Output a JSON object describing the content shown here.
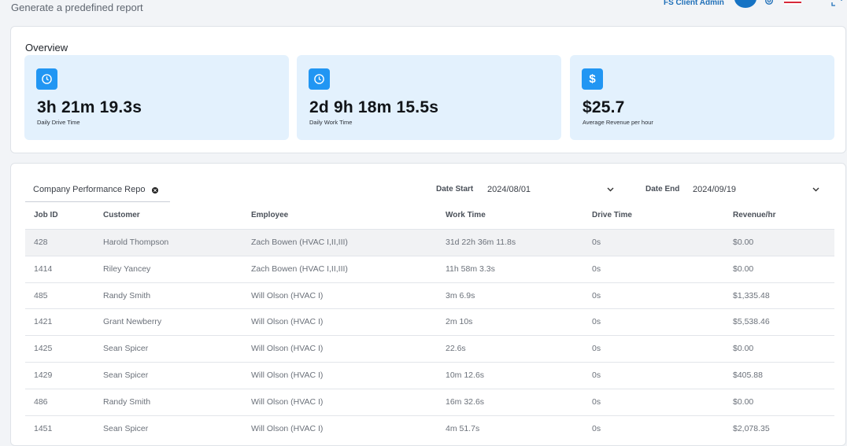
{
  "header": {
    "subtitle": "Generate a predefined report",
    "user_name": "FS Client Admin",
    "icons": [
      "avatar",
      "gear-icon",
      "us-flag-icon",
      "expand-icon"
    ]
  },
  "overview": {
    "title": "Overview",
    "stats": [
      {
        "icon": "clock-icon",
        "value": "3h 21m 19.3s",
        "label": "Daily Drive Time"
      },
      {
        "icon": "clock-icon",
        "value": "2d 9h 18m 15.5s",
        "label": "Daily Work Time"
      },
      {
        "icon": "dollar-icon",
        "value": "$25.7",
        "label": "Average Revenue per hour"
      }
    ]
  },
  "report": {
    "selected_report": "Company Performance Report",
    "date_start_label": "Date Start",
    "date_start": "2024/08/01",
    "date_end_label": "Date End",
    "date_end": "2024/09/19",
    "columns": [
      "Job ID",
      "Customer",
      "Employee",
      "Work Time",
      "Drive Time",
      "Revenue/hr"
    ],
    "rows": [
      [
        "428",
        "Harold Thompson",
        "Zach Bowen (HVAC I,II,III)",
        "31d 22h 36m 11.8s",
        "0s",
        "$0.00"
      ],
      [
        "1414",
        "Riley Yancey",
        "Zach Bowen (HVAC I,II,III)",
        "11h 58m 3.3s",
        "0s",
        "$0.00"
      ],
      [
        "485",
        "Randy Smith",
        "Will Olson (HVAC I)",
        "3m 6.9s",
        "0s",
        "$1,335.48"
      ],
      [
        "1421",
        "Grant Newberry",
        "Will Olson (HVAC I)",
        "2m 10s",
        "0s",
        "$5,538.46"
      ],
      [
        "1425",
        "Sean Spicer",
        "Will Olson (HVAC I)",
        "22.6s",
        "0s",
        "$0.00"
      ],
      [
        "1429",
        "Sean Spicer",
        "Will Olson (HVAC I)",
        "10m 12.6s",
        "0s",
        "$405.88"
      ],
      [
        "486",
        "Randy Smith",
        "Will Olson (HVAC I)",
        "16m 32.6s",
        "0s",
        "$0.00"
      ],
      [
        "1451",
        "Sean Spicer",
        "Will Olson (HVAC I)",
        "4m 51.7s",
        "0s",
        "$2,078.35"
      ]
    ]
  },
  "colors": {
    "accent": "#2196f3",
    "stat_background": "#e3f1fd",
    "user_link": "#1f6fb8"
  }
}
